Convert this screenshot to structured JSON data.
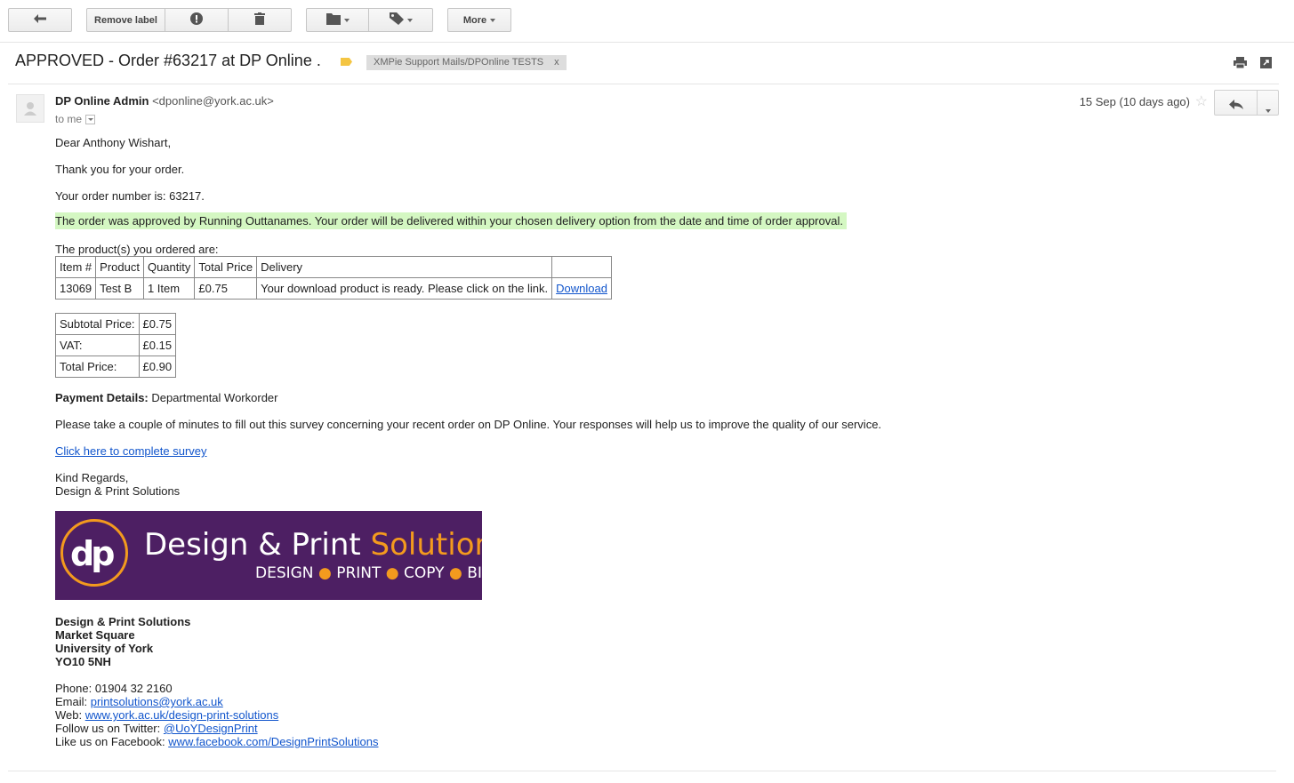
{
  "toolbar": {
    "remove_label": "Remove label",
    "more": "More"
  },
  "subject": {
    "title": "APPROVED - Order #63217 at DP Online .",
    "chip_label": "XMPie Support Mails/DPOnline TESTS",
    "chip_close": "x"
  },
  "sender": {
    "name": "DP Online Admin",
    "email": "<dponline@york.ac.uk>",
    "to": "to me",
    "date": "15 Sep (10 days ago)"
  },
  "body": {
    "greeting": "Dear Anthony Wishart,",
    "thanks": "Thank you for your order.",
    "order_number": "Your order number is: 63217.",
    "approval": "The order was approved by Running Outtanames. Your order will be delivered within your chosen delivery option from the date and time of order approval.",
    "products_intro": "The product(s) you ordered are:",
    "order_table": {
      "headers": [
        "Item #",
        "Product",
        "Quantity",
        "Total Price",
        "Delivery",
        ""
      ],
      "row": [
        "13069",
        "Test B",
        "1 Item",
        "£0.75",
        "Your download product is ready. Please click on the link.",
        "Download"
      ]
    },
    "totals": [
      {
        "label": "Subtotal Price:",
        "value": "£0.75"
      },
      {
        "label": "VAT:",
        "value": "£0.15"
      },
      {
        "label": "Total Price:",
        "value": "£0.90"
      }
    ],
    "payment_label": "Payment Details:",
    "payment_value": "Departmental Workorder",
    "survey_text": "Please take a couple of minutes to fill out this survey concerning your recent order on DP Online. Your responses will help us to improve the quality of our service.",
    "survey_link": "Click here to complete survey",
    "regards": "Kind Regards,",
    "signoff": "Design & Print Solutions"
  },
  "banner": {
    "logo": "dp",
    "title_white": "Design & Print ",
    "title_orange": "Solutions",
    "tag1": "DESIGN",
    "tag2": "PRINT",
    "tag3": "COPY",
    "tag4": "BIND",
    "dot": "●"
  },
  "address": {
    "line1": "Design & Print Solutions",
    "line2": "Market Square",
    "line3": "University of York",
    "line4": "YO10 5NH"
  },
  "contact": {
    "phone": "Phone: 01904 32 2160",
    "email_label": "Email:",
    "email": "printsolutions@york.ac.uk",
    "web_label": "Web:",
    "web": "www.york.ac.uk/design-print-solutions",
    "twitter_label": "Follow us on Twitter:",
    "twitter": "@UoYDesignPrint",
    "facebook_label": "Like us on Facebook:",
    "facebook": "www.facebook.com/DesignPrintSolutions"
  },
  "icons": {
    "back": "back-arrow-icon",
    "spam": "report-spam-icon",
    "delete": "trash-icon",
    "move": "folder-icon",
    "labels": "label-icon",
    "print": "print-icon",
    "newwindow": "new-window-icon",
    "star": "star-icon",
    "reply": "reply-icon"
  },
  "colors": {
    "highlight": "#d4f7c2",
    "link": "#1155cc",
    "banner_bg": "#4d1f63",
    "banner_accent": "#f39a1e",
    "label_tag": "#f4c542"
  }
}
